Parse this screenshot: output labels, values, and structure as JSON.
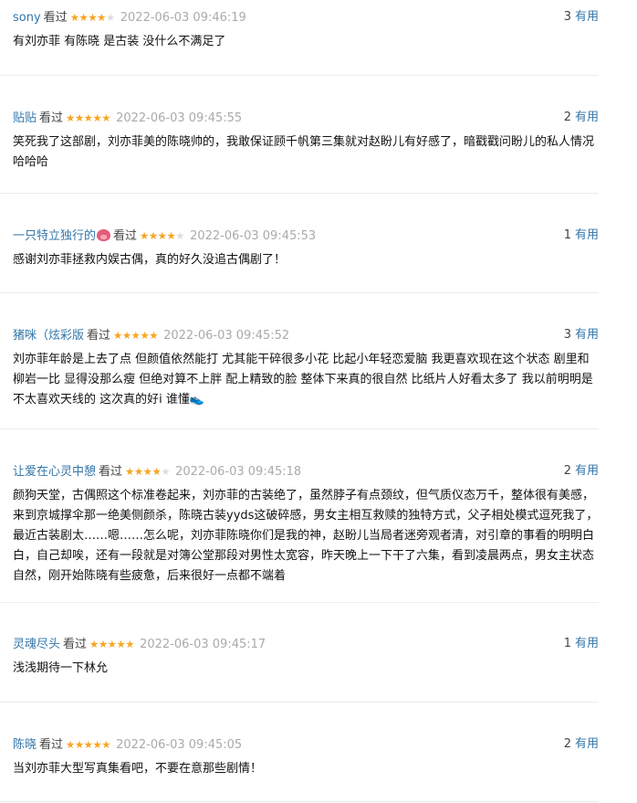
{
  "ui": {
    "watched_label": "看过",
    "useful_label": "有用"
  },
  "comments": [
    {
      "user": "sony",
      "rating": 4,
      "time": "2022-06-03 09:46:19",
      "votes": "3",
      "text": "有刘亦菲 有陈晓 是古装 没什么不满足了"
    },
    {
      "user": "贴贴",
      "rating": 5,
      "time": "2022-06-03 09:45:55",
      "votes": "2",
      "text": "笑死我了这部剧，刘亦菲美的陈晓帅的，我敢保证顾千帆第三集就对赵盼儿有好感了，暗戳戳问盼儿的私人情况哈哈哈"
    },
    {
      "user": "一只特立独行的",
      "user_icon": "pig-face-icon",
      "rating": 4,
      "time": "2022-06-03 09:45:53",
      "votes": "1",
      "text": "感谢刘亦菲拯救内娱古偶，真的好久没追古偶剧了！"
    },
    {
      "user": "猪咪（炫彩版",
      "rating": 5,
      "time": "2022-06-03 09:45:52",
      "votes": "3",
      "text": "刘亦菲年龄是上去了点 但颜值依然能打 尤其能干碎很多小花 比起小年轻恋爱脑 我更喜欢现在这个状态 剧里和柳岩一比 显得没那么瘦 但绝对算不上胖 配上精致的脸 整体下来真的很自然 比纸片人好看太多了 我以前明明是不太喜欢天线的 这次真的好i 谁懂👟"
    },
    {
      "user": "让爱在心灵中憩",
      "rating": 4,
      "time": "2022-06-03 09:45:18",
      "votes": "2",
      "text": "颜狗天堂，古偶照这个标准卷起来，刘亦菲的古装绝了，虽然脖子有点颈纹，但气质仪态万千，整体很有美感，来到京城撑伞那一绝美侧颜杀，陈晓古装yyds这破碎感，男女主相互救赎的独特方式，父子相处模式逗死我了，最近古装剧太……嗯……怎么呢，刘亦菲陈晓你们是我的神，赵盼儿当局者迷旁观者清，对引章的事看的明明白白，自己却唉，还有一段就是对簿公堂那段对男性太宽容，昨天晚上一下干了六集，看到凌晨两点，男女主状态自然，刚开始陈晓有些疲惫，后来很好一点都不端着"
    },
    {
      "user": "灵魂尽头",
      "rating": 5,
      "time": "2022-06-03 09:45:17",
      "votes": "1",
      "text": "浅浅期待一下林允"
    },
    {
      "user": "陈晓",
      "rating": 5,
      "time": "2022-06-03 09:45:05",
      "votes": "2",
      "text": "当刘亦菲大型写真集看吧，不要在意那些剧情！"
    }
  ],
  "colors": {
    "link": "#3377aa",
    "star_on": "#f6a623",
    "star_off": "#dddddd",
    "time": "#aaaaaa",
    "divider": "#ececec"
  }
}
